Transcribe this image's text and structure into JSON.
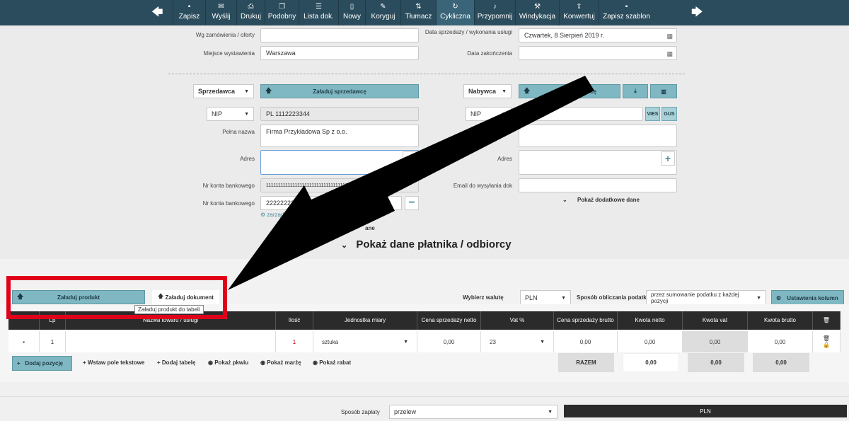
{
  "toolbar": {
    "items": [
      {
        "label": "Zapisz",
        "icon": "save-icon",
        "glyph": "▪"
      },
      {
        "label": "Wyślij",
        "icon": "mail-icon",
        "glyph": "✉"
      },
      {
        "label": "Drukuj",
        "icon": "print-icon",
        "glyph": "⎙"
      },
      {
        "label": "Podobny",
        "icon": "copy-icon",
        "glyph": "❐"
      },
      {
        "label": "Lista dok.",
        "icon": "list-icon",
        "glyph": "☰"
      },
      {
        "label": "Nowy",
        "icon": "new-doc-icon",
        "glyph": "▯"
      },
      {
        "label": "Koryguj",
        "icon": "edit-icon",
        "glyph": "✎"
      },
      {
        "label": "Tłumacz",
        "icon": "translate-icon",
        "glyph": "⇅"
      },
      {
        "label": "Cykliczna",
        "icon": "cycle-icon",
        "glyph": "↻"
      },
      {
        "label": "Przypomnij",
        "icon": "bell-icon",
        "glyph": "♪"
      },
      {
        "label": "Windykacja",
        "icon": "gavel-icon",
        "glyph": "⚒"
      },
      {
        "label": "Konwertuj",
        "icon": "upload-icon",
        "glyph": "⇪"
      },
      {
        "label": "Zapisz szablon",
        "icon": "template-icon",
        "glyph": "▪"
      }
    ],
    "prev": "🡄",
    "next": "🡆"
  },
  "top_form": {
    "order_label": "Wg zamówienia / oferty",
    "order_value": "",
    "place_label": "Miejsce wystawienia",
    "place_value": "Warszawa",
    "sale_date_label": "Data sprzedaży / wykonania usługi",
    "sale_date_value": "Czwartek, 8 Sierpień 2019 r.",
    "end_date_label": "Data zakończenia",
    "end_date_value": ""
  },
  "seller": {
    "type": "Sprzedawca",
    "load_button": "Załaduj sprzedawcę",
    "nip_type": "NIP",
    "nip_value": "PL 1112223344",
    "name_label": "Pełna nazwa",
    "name_value": "Firma Przykładowa Sp z o.o.",
    "address_label": "Adres",
    "address_value": "",
    "bank_label_1": "Nr konta bankowego",
    "bank_value_1": "1111111111111111111111111111111111",
    "bank_label_2": "Nr konta bankowego",
    "bank_value_2": "22222222222222222222222",
    "manage_accounts": "zarządzaj kontami ba",
    "more_fragment": "ane"
  },
  "buyer": {
    "type": "Nabywca",
    "load_button_fragment": "cę",
    "nip_type": "NIP",
    "nip_value": "",
    "vies": "VIES",
    "gus": "GUS",
    "name_label_fragment": "P",
    "name_value": "",
    "address_label": "Adres",
    "address_value": "",
    "email_label": "Email do wysyłania dok",
    "email_value": "",
    "more_data": "Pokaż dodatkowe dane"
  },
  "payer_toggle": "Pokaż dane płatnika / odbiorcy",
  "products": {
    "load_product": "Załaduj produkt",
    "load_document": "Załaduj dokument",
    "tooltip": "Załaduj produkt do tabeli",
    "currency_label": "Wybierz walutę",
    "currency_value": "PLN",
    "tax_method_label": "Sposób obliczania podatku",
    "tax_method_value": "przez sumowanie podatku z każdej pozycji",
    "column_settings": "Ustawienia kolumn"
  },
  "table": {
    "headers": [
      "Lp",
      "Nazwa towaru / usługi",
      "Ilość",
      "Jednostka miary",
      "Cena sprzedaży netto",
      "Vat %",
      "Cena sprzedaży brutto",
      "Kwota netto",
      "Kwota vat",
      "Kwota brutto"
    ],
    "row": {
      "lp": "1",
      "name": "",
      "qty": "1",
      "unit": "sztuka",
      "net_price": "0,00",
      "vat": "23",
      "gross_price": "0,00",
      "net_amount": "0,00",
      "vat_amount": "0,00",
      "gross_amount": "0,00"
    },
    "totals": {
      "label": "RAZEM",
      "net": "0,00",
      "vat": "0,00",
      "gross": "0,00"
    }
  },
  "actions": {
    "add_position": "Dodaj pozycję",
    "insert_text": "Wstaw pole tekstowe",
    "add_table": "Dodaj tabelę",
    "show_pkwiu": "Pokaż pkwiu",
    "show_margin": "Pokaż marżę",
    "show_discount": "Pokaż rabat"
  },
  "payment": {
    "label": "Sposób zapłaty",
    "value": "przelew",
    "currency_header": "PLN"
  }
}
